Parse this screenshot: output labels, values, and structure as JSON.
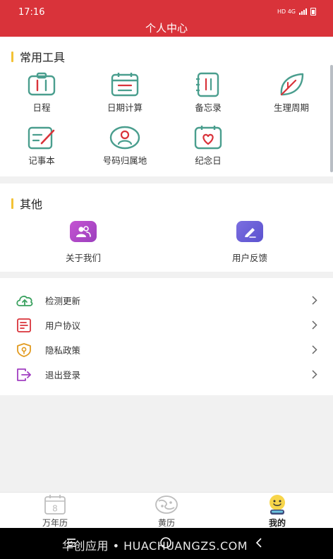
{
  "status_bar": {
    "time": "17:16",
    "indicators": "HD 4G"
  },
  "header": {
    "title": "个人中心"
  },
  "tools_section": {
    "title": "常用工具",
    "items": [
      {
        "label": "日程",
        "icon": "briefcase-icon"
      },
      {
        "label": "日期计算",
        "icon": "calendar-icon"
      },
      {
        "label": "备忘录",
        "icon": "notebook-icon"
      },
      {
        "label": "生理周期",
        "icon": "leaf-icon"
      },
      {
        "label": "记事本",
        "icon": "note-pen-icon"
      },
      {
        "label": "号码归属地",
        "icon": "location-person-icon"
      },
      {
        "label": "纪念日",
        "icon": "heart-calendar-icon"
      }
    ]
  },
  "other_section": {
    "title": "其他",
    "items": [
      {
        "label": "关于我们",
        "icon": "users-icon",
        "color": "#b34fc6"
      },
      {
        "label": "用户反馈",
        "icon": "pen-edit-icon",
        "color": "#6a5fd8"
      }
    ]
  },
  "settings": {
    "items": [
      {
        "label": "检测更新",
        "icon": "cloud-upload-icon",
        "color": "#3aa15f"
      },
      {
        "label": "用户协议",
        "icon": "document-icon",
        "color": "#d9333a"
      },
      {
        "label": "隐私政策",
        "icon": "shield-icon",
        "color": "#e29a1e"
      },
      {
        "label": "退出登录",
        "icon": "logout-icon",
        "color": "#a13ec1"
      }
    ]
  },
  "tab_bar": {
    "tabs": [
      {
        "label": "万年历",
        "icon": "calendar-tab-icon",
        "badge": "8"
      },
      {
        "label": "黄历",
        "icon": "yin-yang-icon"
      },
      {
        "label": "我的",
        "icon": "smiley-avatar-icon",
        "active": true
      }
    ]
  },
  "watermark": "华创应用 • HUACHUANGZS.COM",
  "colors": {
    "primary": "#d9333a",
    "tool_icon": "#4a9e8e",
    "accent_bar": "#f3c235"
  }
}
